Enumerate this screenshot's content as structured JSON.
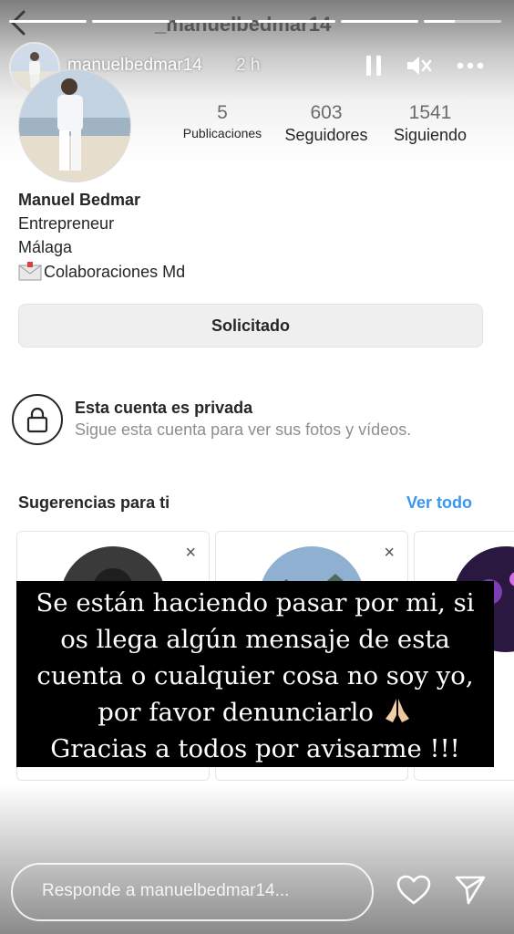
{
  "background_app": {
    "title": "_manuelbedmar14"
  },
  "story": {
    "progress": [
      1.0,
      1.0,
      1.0,
      1.0,
      1.0,
      0.4
    ],
    "username": "manuelbedmar14",
    "time": "2 h",
    "icons": [
      "pause-icon",
      "mute-icon",
      "more-icon"
    ]
  },
  "profile": {
    "stats": [
      {
        "value": "5",
        "label": "Publicaciones"
      },
      {
        "value": "603",
        "label": "Seguidores"
      },
      {
        "value": "1541",
        "label": "Siguiendo"
      }
    ],
    "name": "Manuel Bedmar",
    "bio_lines": [
      "Entrepreneur",
      "Málaga",
      "Colaboraciones Md"
    ],
    "bio_icon": "envelope-icon",
    "requested_button": "Solicitado",
    "private": {
      "title": "Esta cuenta es privada",
      "subtitle": "Sigue esta cuenta para ver sus fotos y vídeos."
    },
    "suggestions": {
      "title": "Sugerencias para ti",
      "see_all": "Ver todo",
      "close_glyph": "×"
    }
  },
  "overlay_text": [
    "Se están haciendo pasar por mi, si",
    "os llega algún mensaje de esta",
    "cuenta o cualquier cosa no soy yo,",
    "por favor denunciarlo",
    "Gracias a todos por avisarme !!!"
  ],
  "overlay_emoji": "praying-hands",
  "reply": {
    "placeholder": "Responde a manuelbedmar14..."
  },
  "colors": {
    "link_blue": "#3897f0",
    "overlay_bg": "#000000",
    "button_bg": "#efefef"
  }
}
